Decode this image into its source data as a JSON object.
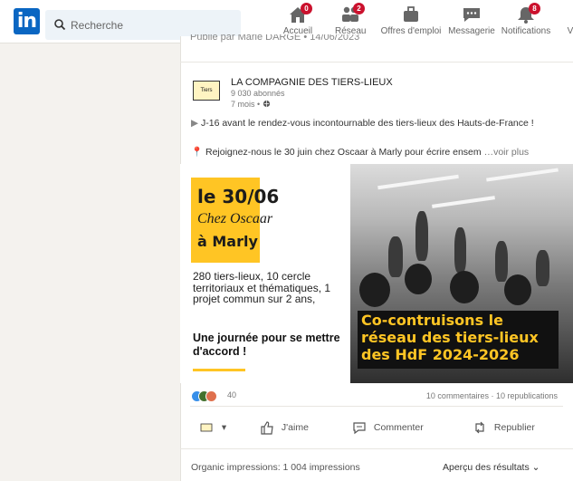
{
  "brand": {
    "logo_text": "in",
    "color": "#0a66c2"
  },
  "search": {
    "placeholder": "Recherche"
  },
  "nav": [
    {
      "label": "Accueil",
      "icon": "home-icon",
      "badge": "0"
    },
    {
      "label": "Réseau",
      "icon": "network-icon",
      "badge": "2"
    },
    {
      "label": "Offres d'emploi",
      "icon": "briefcase-icon"
    },
    {
      "label": "Messagerie",
      "icon": "message-icon"
    },
    {
      "label": "Notifications",
      "icon": "bell-icon",
      "badge": "8"
    },
    {
      "label": "V",
      "icon": "more-icon"
    }
  ],
  "partial_header": "Publié par Marie DARGE • 14/06/2023",
  "post": {
    "company_name": "LA COMPAGNIE DES TIERS-LIEUX",
    "followers": "9 030 abonnés",
    "time": "7 mois • ",
    "text_line1": "J-16 avant le rendez-vous incontournable des tiers-lieux des Hauts-de-France !",
    "text_line2": "Rejoignez-nous le 30 juin chez Oscaar à Marly pour écrire ensem",
    "see_more": "…voir plus",
    "logo_text": "Tiers"
  },
  "poster": {
    "date": "le 30/06",
    "venue": "Chez Oscaar",
    "city": "à Marly",
    "desc": "280 tiers-lieux, 10 cercle territoriaux et thématiques, 1 projet commun sur 2 ans,",
    "tagline": "Une journée pour se mettre d'accord !",
    "banner": "Co-contruisons le réseau des tiers-lieux des HdF 2024-2026",
    "accent": "#ffc524"
  },
  "engagement": {
    "reactions_count": "40",
    "stats": "10 commentaires · 10 republications"
  },
  "actions": {
    "like": "J'aime",
    "comment": "Commenter",
    "repost": "Republier"
  },
  "footer": {
    "impressions": "Organic impressions: 1 004 impressions",
    "results": "Aperçu des résultats"
  }
}
